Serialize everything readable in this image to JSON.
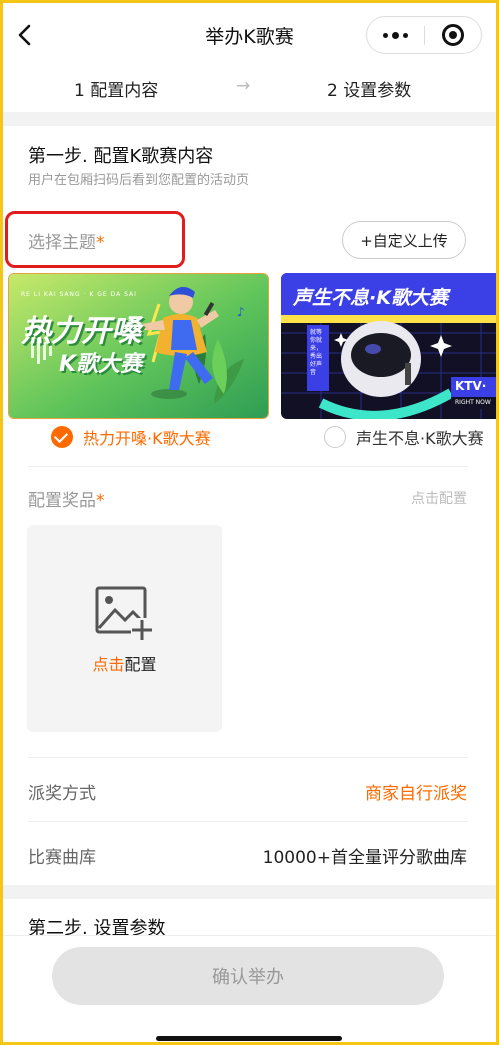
{
  "nav": {
    "title": "举办K歌赛"
  },
  "steps": {
    "step1": "1 配置内容",
    "arrow": "→",
    "step2": "2 设置参数"
  },
  "section1": {
    "title": "第一步. 配置K歌赛内容",
    "subtitle": "用户在包厢扫码后看到您配置的活动页"
  },
  "theme": {
    "label": "选择主题",
    "required_mark": "*",
    "custom_upload": "+自定义上传",
    "options": [
      {
        "name": "热力开嗓·K歌大赛",
        "selected": true,
        "poster": {
          "top_small": "RE LI KAI SANG · K GE DA SAI",
          "line1": "热力开嗓",
          "line2": "K歌大赛"
        }
      },
      {
        "name": "声生不息·K歌大赛",
        "selected": false,
        "poster": {
          "headline": "声生不息·K歌大赛",
          "side_text": "就等你就来，秀出好声音",
          "badge": "KTV·",
          "badge_sub": "RIGHT NOW"
        }
      }
    ]
  },
  "prize": {
    "label": "配置奖品",
    "required_mark": "*",
    "hint": "点击配置",
    "card_highlight": "点击",
    "card_text": "配置"
  },
  "rows": [
    {
      "label": "派奖方式",
      "value": "商家自行派奖",
      "accent": true
    },
    {
      "label": "比赛曲库",
      "value": "10000+首全量评分歌曲库",
      "accent": false
    }
  ],
  "section2": {
    "title": "第二步. 设置参数"
  },
  "footer": {
    "confirm": "确认举办"
  },
  "colors": {
    "accent": "#ff6a00",
    "highlight_box": "#e21b1b",
    "frame": "#f5c518"
  }
}
